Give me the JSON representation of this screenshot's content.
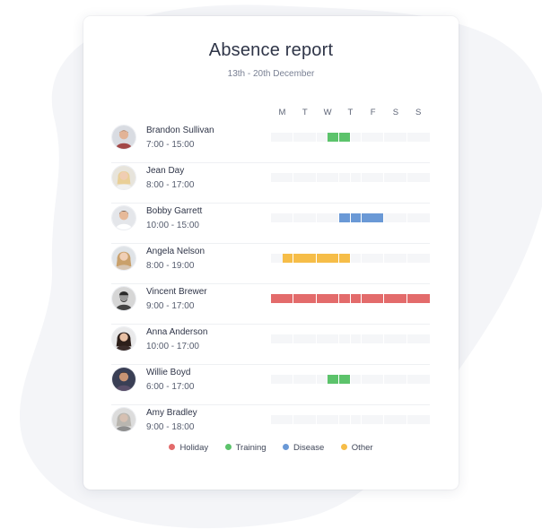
{
  "report": {
    "title": "Absence report",
    "subtitle": "13th - 20th December"
  },
  "days": [
    "M",
    "T",
    "W",
    "T",
    "F",
    "S",
    "S"
  ],
  "colors": {
    "holiday": "#e36b6b",
    "training": "#5cc36b",
    "disease": "#6a99d6",
    "other": "#f6bd48",
    "empty": "#f5f6f8"
  },
  "people": [
    {
      "name": "Brandon Sullivan",
      "hours": "7:00 - 15:00",
      "absence": {
        "type": "training",
        "start": 2.5,
        "end": 3.5
      }
    },
    {
      "name": "Jean Day",
      "hours": "8:00 - 17:00",
      "absence": null
    },
    {
      "name": "Bobby Garrett",
      "hours": "10:00 - 15:00",
      "absence": {
        "type": "disease",
        "start": 3,
        "end": 5
      }
    },
    {
      "name": "Angela Nelson",
      "hours": "8:00 - 19:00",
      "absence": {
        "type": "other",
        "start": 0.5,
        "end": 3.5
      }
    },
    {
      "name": "Vincent Brewer",
      "hours": "9:00 - 17:00",
      "absence": {
        "type": "holiday",
        "start": 0,
        "end": 7
      }
    },
    {
      "name": "Anna Anderson",
      "hours": "10:00 - 17:00",
      "absence": null
    },
    {
      "name": "Willie Boyd",
      "hours": "6:00 - 17:00",
      "absence": {
        "type": "training",
        "start": 2.5,
        "end": 3.5
      }
    },
    {
      "name": "Amy Bradley",
      "hours": "9:00 - 18:00",
      "absence": null
    }
  ],
  "legend": [
    {
      "key": "holiday",
      "label": "Holiday"
    },
    {
      "key": "training",
      "label": "Training"
    },
    {
      "key": "disease",
      "label": "Disease"
    },
    {
      "key": "other",
      "label": "Other"
    }
  ]
}
